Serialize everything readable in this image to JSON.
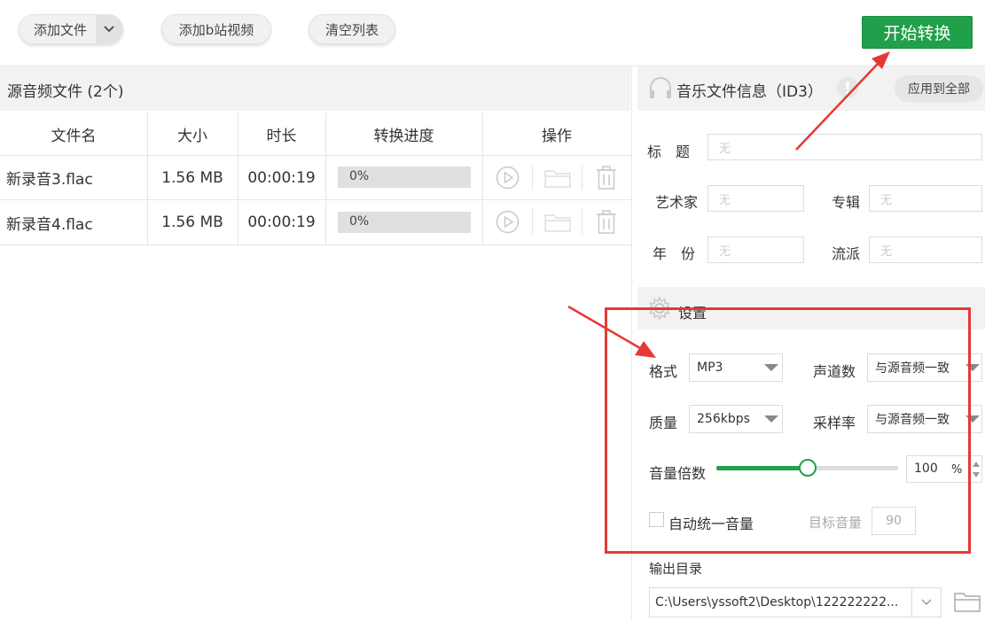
{
  "toolbar": {
    "add_file": "添加文件",
    "add_bilibili": "添加b站视频",
    "clear_list": "清空列表",
    "start": "开始转换"
  },
  "source": {
    "title": "源音频文件 (2个)",
    "columns": [
      "文件名",
      "大小",
      "时长",
      "转换进度",
      "操作"
    ],
    "rows": [
      {
        "name": "新录音3.flac",
        "size": "1.56 MB",
        "duration": "00:00:19",
        "progress": "0%",
        "progress_value": 0
      },
      {
        "name": "新录音4.flac",
        "size": "1.56 MB",
        "duration": "00:00:19",
        "progress": "0%",
        "progress_value": 0
      }
    ]
  },
  "id3": {
    "title": "音乐文件信息（ID3）",
    "apply_all": "应用到全部",
    "title_label": "标　题",
    "artist_label": "艺术家",
    "album_label": "专辑",
    "year_label": "年　份",
    "genre_label": "流派",
    "placeholder": "无"
  },
  "settings": {
    "title": "设置",
    "format_label": "格式",
    "format_value": "MP3",
    "channels_label": "声道数",
    "channels_value": "与源音频一致",
    "quality_label": "质量",
    "quality_value": "256kbps",
    "samplerate_label": "采样率",
    "samplerate_value": "与源音频一致",
    "volume_label": "音量倍数",
    "volume_value": "100",
    "volume_unit": "%",
    "volume_fraction": 0.5,
    "auto_normalize_label": "自动统一音量",
    "target_volume_label": "目标音量",
    "target_volume_value": "90"
  },
  "output": {
    "label": "输出目录",
    "path": "C:\\Users\\yssoft2\\Desktop\\122222222..."
  },
  "colors": {
    "accent_green": "#20a04a",
    "annotation_red": "#e53935"
  }
}
